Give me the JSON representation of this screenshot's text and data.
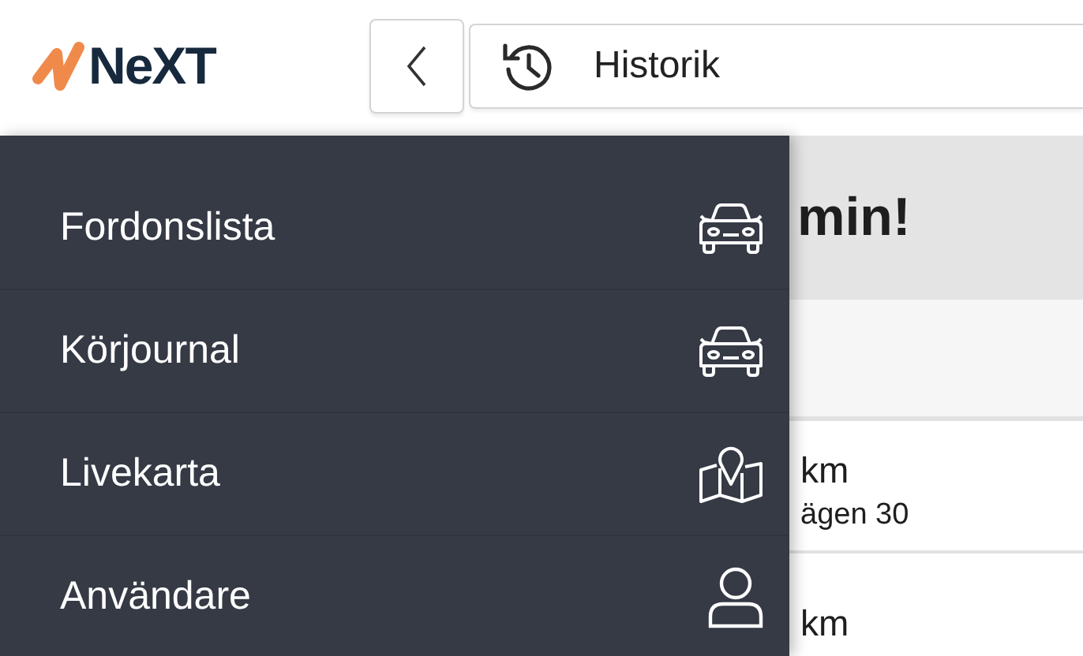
{
  "header": {
    "logo_text": "NeXT",
    "search": {
      "value": "Historik"
    }
  },
  "background": {
    "heading": "min!",
    "rows": [
      {
        "primary": "km",
        "secondary": "ägen 30"
      },
      {
        "primary": "km"
      }
    ]
  },
  "drawer": {
    "items": [
      {
        "label": "Fordonslista",
        "kind": "vehicle"
      },
      {
        "label": "Körjournal",
        "kind": "vehicle"
      },
      {
        "label": "Livekarta",
        "kind": "map"
      },
      {
        "label": "Användare",
        "kind": "user"
      }
    ]
  }
}
